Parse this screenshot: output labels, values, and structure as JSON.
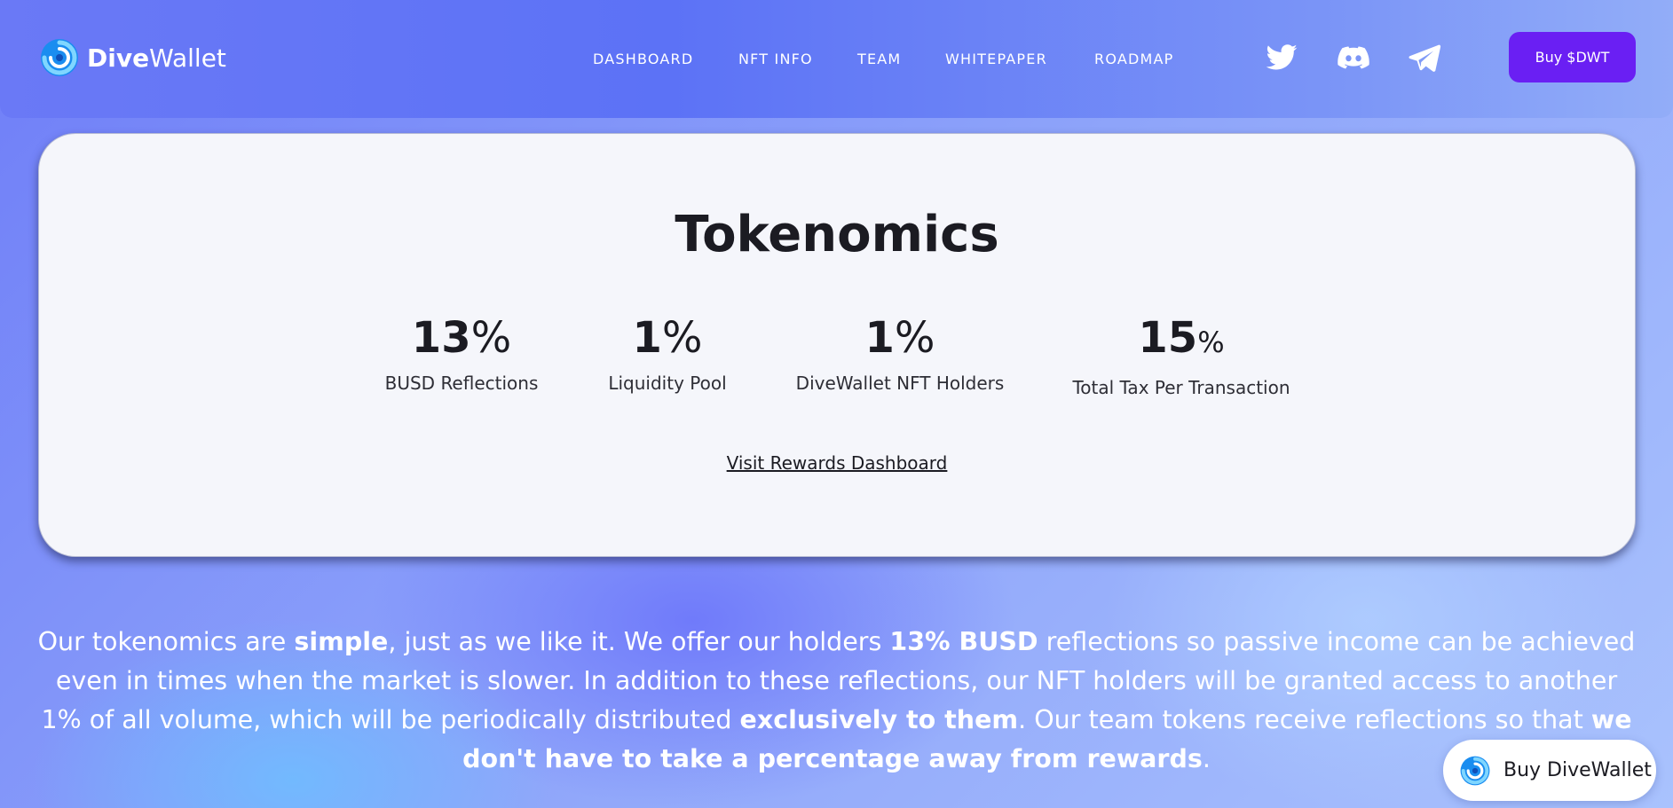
{
  "brand": {
    "name_bold": "Dive",
    "name_rest": "Wallet",
    "logo_icon": "swirl-logo-icon"
  },
  "nav": {
    "links": [
      "DASHBOARD",
      "NFT INFO",
      "TEAM",
      "WHITEPAPER",
      "ROADMAP"
    ],
    "social": [
      "twitter-icon",
      "discord-icon",
      "telegram-icon"
    ],
    "buy_label": "Buy $DWT"
  },
  "tokenomics": {
    "title": "Tokenomics",
    "stats": [
      {
        "value": "13",
        "suffix": "%",
        "label": "BUSD Reflections"
      },
      {
        "value": "1",
        "suffix": "%",
        "label": "Liquidity Pool"
      },
      {
        "value": "1",
        "suffix": "%",
        "label": "DiveWallet NFT Holders"
      },
      {
        "value": "15",
        "suffix": "%",
        "label": "Total Tax Per Transaction"
      }
    ],
    "link": "Visit Rewards Dashboard"
  },
  "description": {
    "p1": "Our tokenomics are ",
    "b1": "simple",
    "p2": ", just as we like it. We offer our holders ",
    "b2": "13% BUSD",
    "p3": " reflections so passive income can be achieved even in times when the market is slower. In addition to these reflections, our NFT holders will be granted access to another 1% of all volume, which will be periodically distributed ",
    "b3": "exclusively to them",
    "p4": ". Our team tokens receive reflections so that ",
    "b4": "we don't have to take a percentage away from rewards",
    "p5": "."
  },
  "floating_button": {
    "label": "Buy DiveWallet"
  },
  "colors": {
    "accent": "#6a1ff3",
    "nav_bg": "#5c72f6",
    "card_bg": "#f5f6fb",
    "text_dark": "#1b1b22"
  }
}
